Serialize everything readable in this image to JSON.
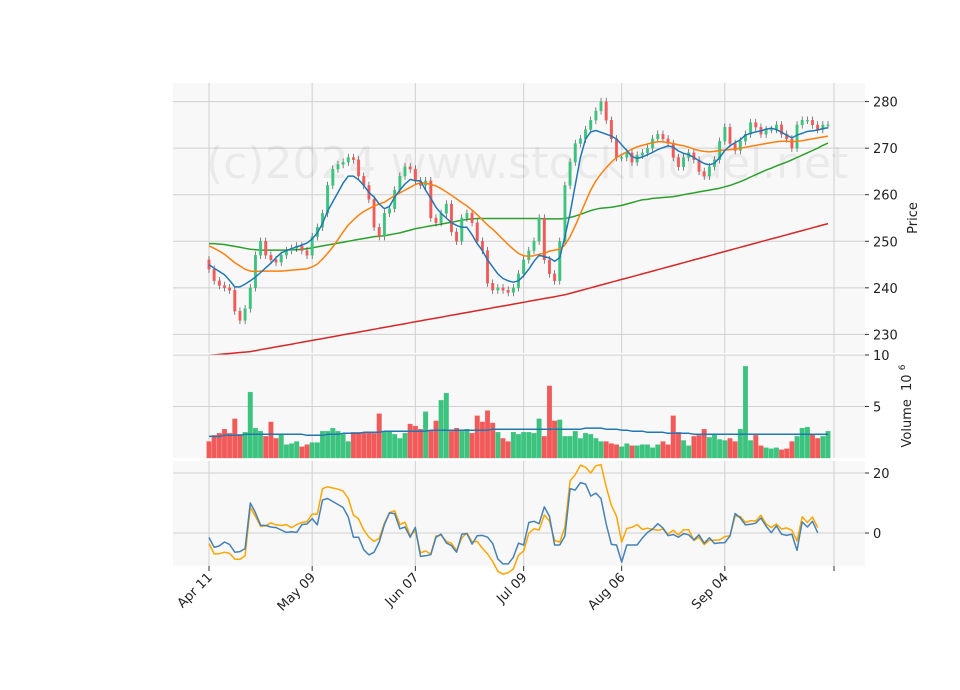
{
  "watermark": "(c)2024 www.stockmodel.net",
  "colors": {
    "up": "#3cc47f",
    "down": "#f25a5a",
    "ma_short": "#1f77b4",
    "ma_mid": "#ff7f0e",
    "ma_long": "#2ca02c",
    "ma_200": "#d62728",
    "osc_fast": "#4682b4",
    "osc_slow": "#ffa500"
  },
  "chart_data": [
    {
      "type": "candlestick",
      "panel": "price",
      "ylabel": "Price",
      "ylim": [
        226,
        284
      ],
      "yticks": [
        230,
        240,
        250,
        260,
        270,
        280
      ],
      "xticks": [
        {
          "i": 0,
          "label": "Apr 11"
        },
        {
          "i": 20,
          "label": "May 09"
        },
        {
          "i": 40,
          "label": "Jun 07"
        },
        {
          "i": 61,
          "label": "Jul 09"
        },
        {
          "i": 80,
          "label": "Aug 06"
        },
        {
          "i": 100,
          "label": "Sep 04"
        },
        {
          "i": 120,
          "label": ""
        }
      ],
      "close": [
        244.0,
        241.5,
        240.5,
        240.0,
        239.5,
        235.0,
        233.0,
        235.5,
        240.0,
        247.0,
        250.0,
        247.0,
        246.0,
        245.5,
        247.0,
        248.0,
        248.5,
        249.0,
        248.0,
        247.0,
        251.0,
        253.0,
        256.0,
        262.0,
        265.5,
        266.5,
        267.0,
        268.0,
        267.5,
        264.0,
        262.0,
        259.0,
        253.0,
        251.0,
        256.0,
        257.0,
        261.0,
        264.0,
        266.0,
        265.5,
        263.0,
        262.0,
        263.0,
        255.0,
        254.0,
        256.0,
        258.0,
        252.0,
        250.0,
        255.0,
        256.0,
        254.0,
        250.0,
        248.0,
        241.0,
        239.5,
        240.0,
        239.5,
        239.0,
        240.0,
        243.0,
        246.0,
        248.0,
        250.0,
        255.0,
        246.0,
        243.0,
        241.5,
        250.0,
        262.0,
        267.0,
        271.0,
        272.0,
        274.0,
        276.0,
        278.0,
        280.0,
        276.0,
        272.0,
        268.0,
        268.0,
        269.0,
        267.0,
        268.5,
        269.0,
        270.0,
        272.0,
        273.0,
        272.0,
        271.0,
        268.0,
        266.0,
        268.0,
        269.0,
        267.5,
        265.0,
        264.0,
        266.0,
        267.5,
        271.5,
        274.5,
        271.0,
        269.5,
        271.5,
        273.0,
        275.5,
        274.5,
        273.0,
        274.0,
        274.0,
        275.0,
        273.0,
        272.0,
        270.0,
        275.0,
        276.0,
        276.0,
        275.0,
        274.0,
        275.0,
        275.0
      ],
      "ma_short": [
        245.0,
        244.2,
        243.5,
        242.8,
        241.6,
        240.2,
        240.2,
        240.8,
        241.5,
        242.3,
        243.3,
        244.3,
        245.3,
        246.5,
        247.5,
        248.0,
        248.4,
        248.8,
        249.2,
        249.6,
        250.5,
        251.8,
        253.8,
        256.5,
        258.5,
        260.5,
        262.5,
        264.0,
        264.0,
        263.2,
        262.0,
        260.5,
        259.5,
        258.0,
        257.0,
        257.5,
        259.5,
        261.0,
        262.3,
        263.3,
        263.0,
        263.0,
        261.0,
        259.2,
        257.3,
        256.0,
        255.0,
        254.0,
        253.4,
        253.0,
        253.0,
        251.4,
        249.5,
        248.0,
        246.0,
        244.5,
        243.0,
        242.0,
        241.5,
        241.2,
        241.5,
        242.6,
        244.0,
        245.7,
        247.0,
        246.7,
        246.4,
        245.7,
        246.5,
        251.0,
        256.0,
        262.0,
        268.0,
        272.0,
        273.5,
        273.8,
        273.4,
        273.0,
        272.6,
        272.0,
        270.7,
        269.5,
        268.2,
        267.8,
        268.1,
        268.6,
        269.1,
        269.7,
        270.1,
        270.5,
        270.2,
        269.4,
        268.9,
        268.6,
        268.0,
        267.3,
        266.7,
        266.4,
        266.8,
        268.0,
        269.5,
        270.5,
        271.2,
        271.8,
        272.8,
        273.2,
        273.5,
        273.7,
        274.1,
        274.3,
        274.0,
        273.4,
        272.8,
        272.2,
        272.8,
        273.2,
        273.6,
        273.7,
        273.9,
        274.2,
        274.4
      ],
      "ma_mid": [
        249.0,
        248.5,
        247.9,
        247.2,
        246.3,
        245.4,
        244.7,
        244.0,
        243.6,
        243.5,
        243.6,
        243.6,
        243.6,
        243.6,
        243.6,
        243.7,
        243.8,
        243.9,
        244.0,
        244.1,
        244.5,
        245.1,
        246.2,
        247.4,
        248.8,
        250.4,
        252.0,
        253.5,
        254.6,
        255.6,
        256.4,
        257.0,
        257.6,
        258.0,
        258.4,
        259.1,
        259.8,
        260.4,
        261.0,
        261.6,
        262.2,
        262.6,
        262.5,
        262.2,
        261.9,
        261.3,
        260.6,
        259.9,
        259.1,
        258.3,
        257.6,
        256.7,
        255.7,
        254.6,
        253.5,
        252.6,
        251.5,
        250.4,
        249.3,
        248.3,
        247.4,
        246.9,
        246.8,
        246.9,
        247.2,
        247.4,
        247.9,
        248.1,
        248.3,
        249.2,
        251.0,
        253.3,
        255.9,
        258.5,
        261.0,
        263.0,
        264.5,
        265.8,
        267.0,
        268.0,
        268.6,
        269.2,
        269.8,
        270.3,
        270.6,
        270.9,
        271.2,
        271.4,
        271.4,
        271.2,
        271.0,
        270.7,
        270.5,
        270.2,
        269.8,
        269.5,
        269.3,
        269.2,
        269.3,
        269.5,
        269.6,
        269.7,
        269.8,
        270.0,
        270.2,
        270.4,
        270.6,
        270.8,
        271.0,
        271.2,
        271.4,
        271.5,
        271.5,
        271.4,
        271.5,
        271.6,
        271.8,
        272.0,
        272.2,
        272.4,
        272.6
      ],
      "ma_long": [
        249.5,
        249.5,
        249.4,
        249.3,
        249.1,
        248.9,
        248.7,
        248.5,
        248.3,
        248.2,
        248.1,
        248.1,
        248.1,
        248.1,
        248.1,
        248.1,
        248.2,
        248.2,
        248.3,
        248.4,
        248.6,
        248.8,
        249.0,
        249.2,
        249.4,
        249.6,
        249.8,
        250.0,
        250.2,
        250.4,
        250.6,
        250.8,
        251.0,
        251.1,
        251.2,
        251.4,
        251.6,
        251.8,
        252.1,
        252.4,
        252.7,
        252.9,
        253.1,
        253.3,
        253.5,
        253.7,
        253.9,
        254.1,
        254.3,
        254.5,
        254.7,
        254.8,
        254.9,
        254.9,
        254.9,
        254.9,
        254.9,
        254.9,
        254.9,
        254.9,
        254.9,
        254.9,
        254.9,
        254.9,
        254.9,
        254.8,
        254.8,
        254.8,
        254.8,
        254.9,
        255.1,
        255.4,
        255.8,
        256.2,
        256.6,
        256.9,
        257.1,
        257.2,
        257.3,
        257.5,
        257.7,
        258.0,
        258.3,
        258.6,
        258.9,
        259.0,
        259.2,
        259.3,
        259.4,
        259.5,
        259.6,
        259.8,
        260.0,
        260.2,
        260.4,
        260.6,
        260.8,
        261.0,
        261.2,
        261.4,
        261.7,
        262.0,
        262.4,
        262.8,
        263.3,
        263.8,
        264.3,
        264.8,
        265.3,
        265.7,
        266.2,
        266.6,
        267.0,
        267.5,
        268.0,
        268.5,
        269.0,
        269.5,
        270.0,
        270.6,
        271.1
      ],
      "ma_200": [
        225.5,
        225.6,
        225.7,
        225.8,
        225.9,
        226.0,
        226.1,
        226.2,
        226.3,
        226.5,
        226.7,
        226.9,
        227.1,
        227.3,
        227.5,
        227.7,
        227.9,
        228.1,
        228.3,
        228.5,
        228.7,
        228.9,
        229.1,
        229.3,
        229.5,
        229.7,
        229.9,
        230.1,
        230.3,
        230.5,
        230.7,
        230.9,
        231.1,
        231.3,
        231.5,
        231.7,
        231.9,
        232.1,
        232.3,
        232.5,
        232.7,
        232.9,
        233.1,
        233.3,
        233.5,
        233.7,
        233.9,
        234.1,
        234.3,
        234.5,
        234.7,
        234.9,
        235.1,
        235.3,
        235.5,
        235.7,
        235.9,
        236.1,
        236.3,
        236.5,
        236.7,
        236.9,
        237.1,
        237.3,
        237.5,
        237.7,
        237.9,
        238.1,
        238.3,
        238.5,
        238.8,
        239.1,
        239.4,
        239.7,
        240.0,
        240.3,
        240.6,
        240.9,
        241.2,
        241.5,
        241.8,
        242.1,
        242.4,
        242.7,
        243.0,
        243.3,
        243.6,
        243.9,
        244.2,
        244.5,
        244.8,
        245.1,
        245.4,
        245.7,
        246.0,
        246.3,
        246.6,
        246.9,
        247.2,
        247.5,
        247.8,
        248.1,
        248.4,
        248.7,
        249.0,
        249.3,
        249.6,
        249.9,
        250.2,
        250.5,
        250.8,
        251.1,
        251.4,
        251.7,
        252.0,
        252.3,
        252.6,
        252.9,
        253.2,
        253.5,
        253.8
      ]
    },
    {
      "type": "bar",
      "panel": "volume",
      "ylabel": "Volume",
      "yunit": "10^6",
      "ylim": [
        0,
        10
      ],
      "yticks": [
        5,
        10
      ],
      "volume": [
        1.6,
        2.2,
        2.4,
        2.8,
        2.4,
        3.8,
        2.3,
        2.5,
        6.4,
        2.9,
        2.6,
        2.1,
        3.5,
        1.9,
        2.3,
        1.3,
        1.4,
        1.6,
        1.1,
        1.3,
        1.5,
        1.5,
        2.6,
        2.6,
        2.9,
        2.6,
        2.3,
        1.6,
        2.5,
        2.5,
        2.5,
        2.5,
        2.4,
        4.3,
        2.6,
        2.6,
        2.3,
        1.9,
        2.4,
        3.3,
        3.1,
        2.8,
        4.5,
        2.7,
        3.6,
        5.6,
        6.3,
        2.6,
        2.9,
        2.6,
        2.8,
        2.4,
        4.1,
        3.5,
        4.6,
        3.4,
        2.5,
        1.9,
        1.6,
        2.5,
        2.3,
        2.5,
        2.5,
        2.4,
        3.8,
        2.1,
        7.0,
        3.6,
        3.7,
        2.1,
        2.1,
        2.6,
        1.9,
        2.4,
        2.3,
        1.9,
        1.6,
        1.6,
        1.4,
        1.3,
        1.1,
        1.4,
        1.2,
        1.2,
        1.3,
        1.3,
        1.0,
        1.3,
        1.6,
        1.3,
        4.1,
        2.5,
        1.7,
        1.2,
        2.1,
        2.2,
        2.8,
        2.0,
        2.3,
        1.8,
        1.7,
        1.9,
        1.6,
        2.8,
        8.9,
        1.7,
        2.2,
        1.2,
        1.0,
        0.9,
        1.0,
        0.8,
        0.9,
        1.6,
        2.1,
        2.9,
        3.0,
        2.3,
        1.9,
        2.1,
        2.6
      ],
      "volume_ma": [
        2.1,
        2.1,
        2.1,
        2.2,
        2.2,
        2.2,
        2.2,
        2.3,
        2.3,
        2.3,
        2.3,
        2.3,
        2.3,
        2.3,
        2.3,
        2.3,
        2.3,
        2.3,
        2.3,
        2.2,
        2.2,
        2.2,
        2.2,
        2.3,
        2.3,
        2.3,
        2.4,
        2.4,
        2.4,
        2.4,
        2.5,
        2.5,
        2.5,
        2.5,
        2.6,
        2.6,
        2.6,
        2.6,
        2.6,
        2.6,
        2.6,
        2.6,
        2.6,
        2.7,
        2.7,
        2.7,
        2.7,
        2.7,
        2.7,
        2.7,
        2.7,
        2.7,
        2.7,
        2.7,
        2.7,
        2.8,
        2.8,
        2.8,
        2.8,
        2.8,
        2.8,
        2.8,
        2.8,
        2.8,
        2.8,
        2.8,
        2.8,
        2.8,
        2.8,
        2.8,
        2.8,
        2.8,
        2.8,
        2.9,
        2.9,
        2.9,
        2.9,
        2.8,
        2.8,
        2.8,
        2.7,
        2.7,
        2.6,
        2.6,
        2.6,
        2.5,
        2.5,
        2.5,
        2.5,
        2.4,
        2.4,
        2.4,
        2.4,
        2.4,
        2.3,
        2.3,
        2.3,
        2.3,
        2.3,
        2.3,
        2.3,
        2.3,
        2.3,
        2.3,
        2.3,
        2.3,
        2.3,
        2.3,
        2.3,
        2.3,
        2.3,
        2.3,
        2.3,
        2.3,
        2.3,
        2.3,
        2.3,
        2.3,
        2.3,
        2.3,
        2.3
      ]
    },
    {
      "type": "line",
      "panel": "oscillator",
      "ylim": [
        -11,
        24
      ],
      "yticks": [
        0,
        20
      ],
      "fast": [
        -1.5,
        -4.8,
        -4.3,
        -3.0,
        -3.8,
        -6.4,
        -6.2,
        -5.2,
        10.0,
        6.8,
        2.6,
        2.5,
        2.0,
        1.8,
        1.0,
        0.2,
        0.4,
        0.2,
        2.8,
        3.0,
        4.8,
        2.7,
        11.0,
        11.5,
        10.5,
        9.5,
        8.5,
        5.3,
        -1.4,
        -1.4,
        -5.6,
        -7.3,
        -6.4,
        -3.0,
        2.8,
        6.7,
        6.4,
        1.4,
        2.0,
        -1.4,
        1.9,
        -7.8,
        -7.6,
        -7.2,
        -1.4,
        -0.4,
        -3.3,
        -4.2,
        -6.4,
        -0.4,
        -0.2,
        -3.7,
        -0.9,
        -0.8,
        -1.4,
        -3.5,
        -8.7,
        -10.3,
        -10.3,
        -8.1,
        -3.4,
        -4.0,
        3.5,
        3.9,
        3.1,
        8.7,
        5.5,
        -4.0,
        -4.0,
        -1.0,
        14.8,
        14.3,
        16.8,
        16.3,
        12.3,
        13.3,
        11.5,
        3.0,
        -3.8,
        -4.0,
        -9.7,
        -4.0,
        -4.0,
        -4.0,
        -1.7,
        0.2,
        1.3,
        3.1,
        1.7,
        -0.9,
        -0.5,
        -1.4,
        -0.2,
        -0.6,
        -2.3,
        -0.6,
        -3.4,
        -1.6,
        -3.5,
        -3.3,
        -3.2,
        -1.0,
        6.5,
        5.0,
        2.7,
        2.9,
        3.3,
        5.0,
        2.3,
        0.1,
        2.4,
        -0.4,
        -0.8,
        -0.4,
        -5.8,
        3.7,
        2.0,
        3.9,
        0.1
      ],
      "slow": [
        -3.5,
        -7.0,
        -6.9,
        -6.4,
        -6.8,
        -8.7,
        -8.8,
        -7.6,
        8.5,
        5.6,
        2.2,
        2.4,
        3.4,
        2.7,
        2.5,
        2.8,
        1.8,
        2.8,
        3.5,
        3.8,
        6.3,
        6.3,
        14.8,
        15.4,
        15.0,
        14.6,
        14.0,
        11.5,
        6.0,
        4.7,
        1.0,
        -1.4,
        -2.8,
        -1.8,
        3.2,
        6.8,
        7.4,
        2.8,
        3.6,
        -0.9,
        0.8,
        -6.6,
        -6.0,
        -7.0,
        -1.0,
        -0.7,
        -2.8,
        -3.4,
        -5.9,
        -1.6,
        0.0,
        -3.0,
        -2.8,
        -5.1,
        -7.0,
        -9.5,
        -12.8,
        -13.7,
        -13.2,
        -12.0,
        -7.4,
        -6.0,
        -0.1,
        1.4,
        1.0,
        6.0,
        4.0,
        -2.5,
        -3.0,
        1.9,
        17.4,
        19.4,
        22.6,
        21.9,
        20.0,
        22.4,
        22.8,
        15.4,
        9.2,
        5.6,
        -3.0,
        1.5,
        1.9,
        2.8,
        1.2,
        1.6,
        1.2,
        0.9,
        1.3,
        -0.3,
        0.9,
        -0.6,
        1.1,
        1.1,
        -2.5,
        -1.4,
        -3.9,
        -2.4,
        -2.4,
        -2.3,
        -1.2,
        -0.9,
        5.7,
        5.5,
        3.5,
        4.1,
        4.0,
        5.9,
        3.0,
        1.8,
        3.0,
        1.3,
        1.7,
        0.9,
        -2.7,
        5.4,
        3.5,
        5.3,
        1.8
      ]
    }
  ]
}
